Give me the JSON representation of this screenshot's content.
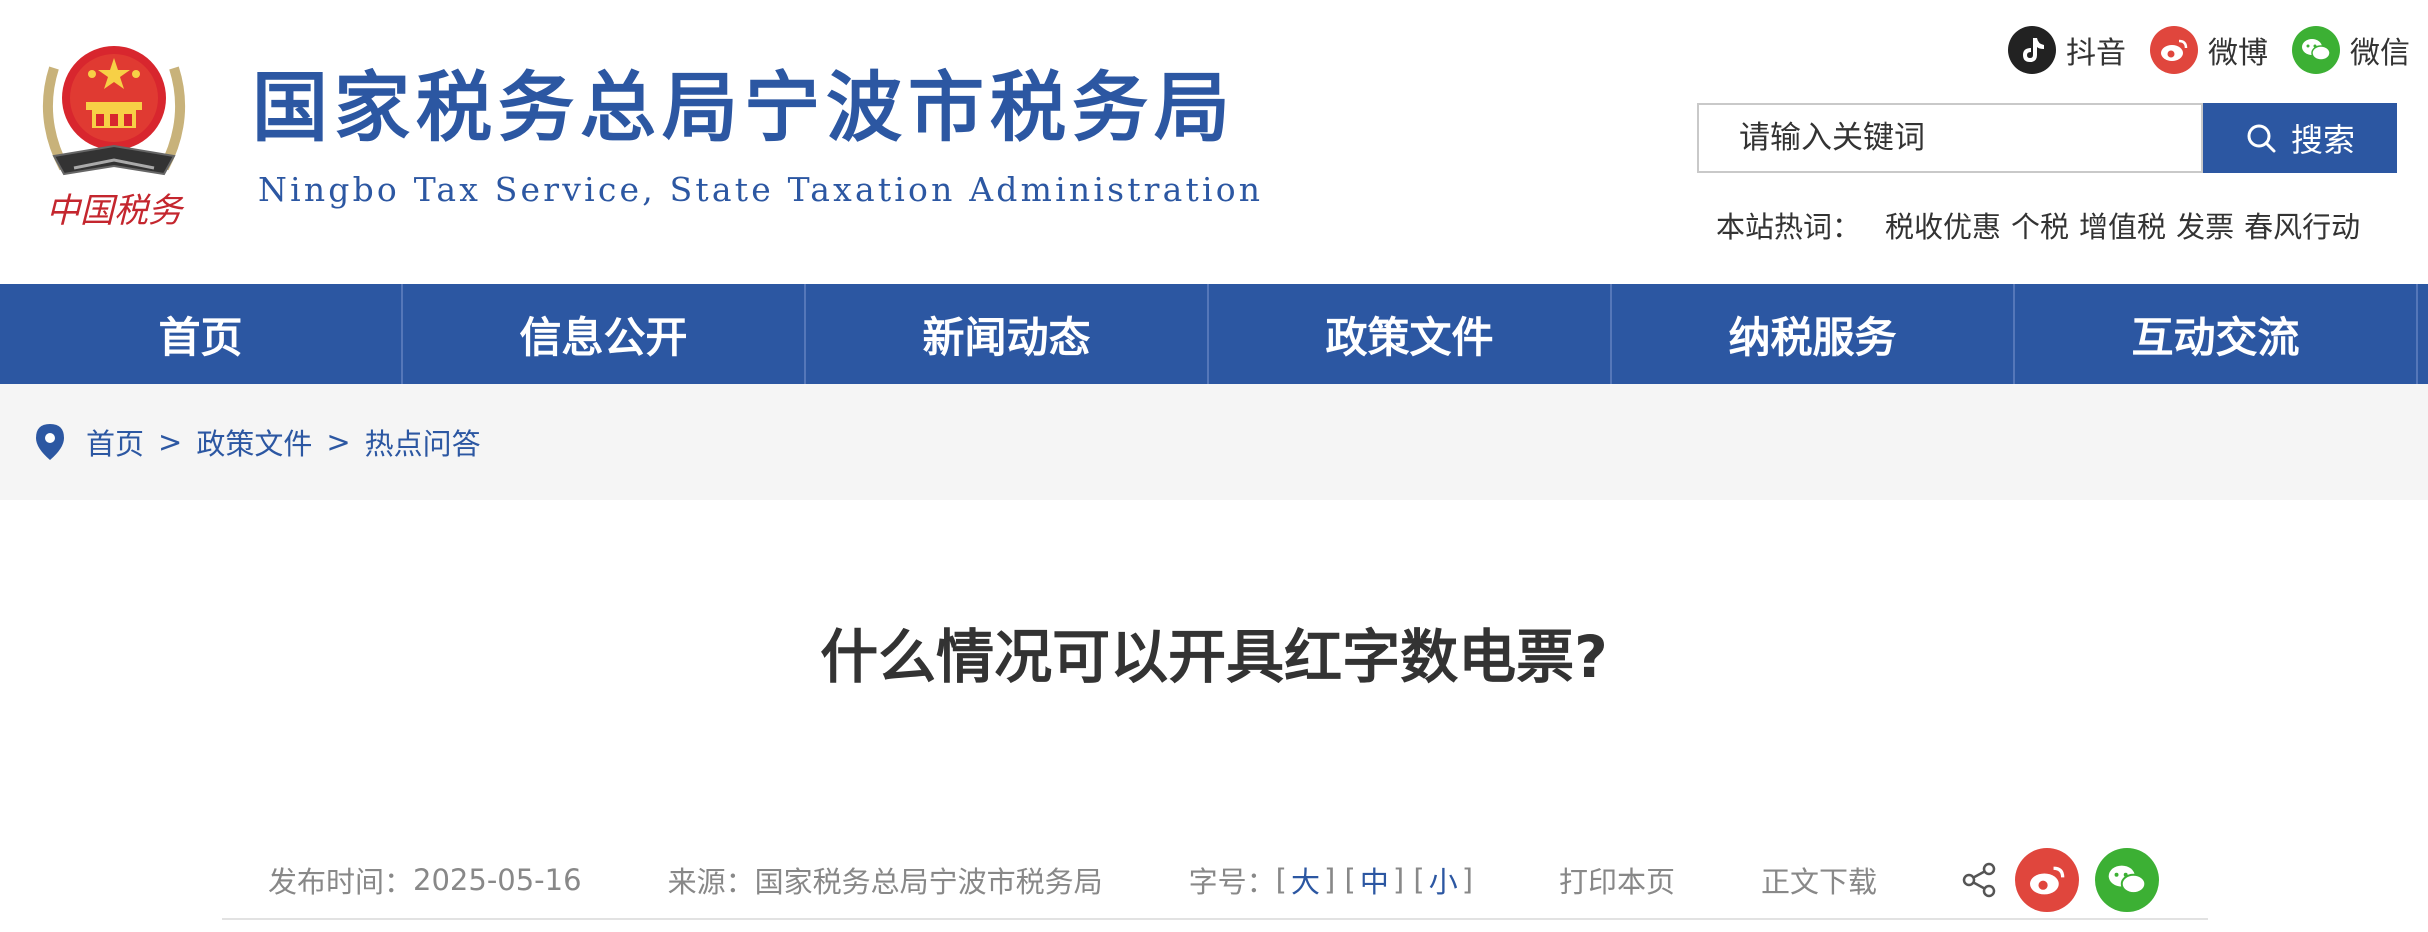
{
  "header": {
    "emblem_text": "中国税务",
    "site_title": "国家税务总局宁波市税务局",
    "site_subtitle": "Ningbo Tax Service, State Taxation Administration",
    "social": [
      {
        "label": "抖音",
        "icon": "tiktok-icon",
        "color": "#222222"
      },
      {
        "label": "微博",
        "icon": "weibo-icon",
        "color": "#e0463d"
      },
      {
        "label": "微信",
        "icon": "wechat-icon",
        "color": "#3cb034"
      }
    ],
    "search": {
      "placeholder": "请输入关键词",
      "button_label": "搜索"
    },
    "hotwords": {
      "label": "本站热词：",
      "items": [
        "税收优惠",
        "个税",
        "增值税",
        "发票",
        "春风行动"
      ]
    }
  },
  "nav": {
    "items": [
      "首页",
      "信息公开",
      "新闻动态",
      "政策文件",
      "纳税服务",
      "互动交流"
    ]
  },
  "breadcrumb": {
    "items": [
      "首页",
      "政策文件",
      "热点问答"
    ],
    "separator": ">"
  },
  "article": {
    "title": "什么情况可以开具红字数电票?",
    "meta": {
      "date_label": "发布时间：",
      "date": "2025-05-16",
      "source_label": "来源：",
      "source": "国家税务总局宁波市税务局",
      "font_size_label": "字号：",
      "font_sizes": [
        "大",
        "中",
        "小"
      ],
      "print": "打印本页",
      "download": "正文下载"
    }
  },
  "colors": {
    "brand": "#2c57a2",
    "weibo": "#e0463d",
    "wechat": "#3cb034"
  }
}
